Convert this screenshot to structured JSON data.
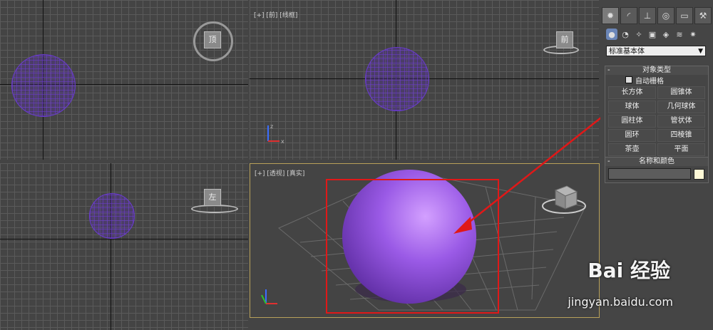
{
  "viewports": {
    "front_label": "[+] [前] [线框]",
    "perspective_label": "[+] [透视] [真实]",
    "top_cube_label": "顶",
    "front_cube_label": "前",
    "left_cube_label": "左"
  },
  "panel": {
    "tab_icons": [
      "create-icon",
      "modify-icon",
      "hierarchy-icon",
      "motion-icon",
      "display-icon",
      "utilities-icon"
    ],
    "category_dropdown": "标准基本体",
    "object_type": {
      "title": "对象类型",
      "auto_grid": "自动栅格",
      "buttons": [
        "长方体",
        "圆锥体",
        "球体",
        "几何球体",
        "圆柱体",
        "管状体",
        "圆环",
        "四棱锥",
        "茶壶",
        "平面"
      ]
    },
    "name_color": {
      "title": "名称和颜色",
      "name_value": ""
    }
  },
  "colors": {
    "highlight": "#e01818",
    "sphere": "#8c4fd8",
    "object_color": "#fdf8d6"
  },
  "watermark": {
    "brand": "Bai 经验",
    "url": "jingyan.baidu.com"
  }
}
